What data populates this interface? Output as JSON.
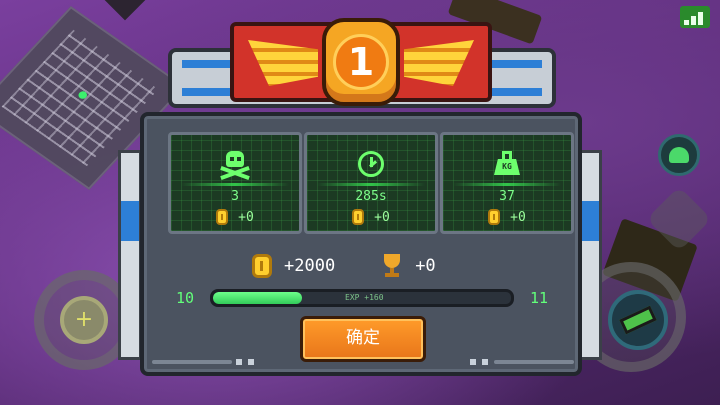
{
  "rank": {
    "number": "1"
  },
  "stats": [
    {
      "icon": "skull-crossbones-icon",
      "value": "3",
      "reward": "+0"
    },
    {
      "icon": "clock-icon",
      "value": "285s",
      "reward": "+0"
    },
    {
      "icon": "weight-icon",
      "icon_text": "KG",
      "value": "37",
      "reward": "+0"
    }
  ],
  "totals": {
    "coins": "+2000",
    "trophies": "+0"
  },
  "level": {
    "current": "10",
    "next": "11",
    "exp_label": "EXP +160",
    "progress": 0.3
  },
  "confirm_button": {
    "label": "确定"
  },
  "colors": {
    "accent_green": "#62ff7a",
    "button_orange": "#ff9b2a",
    "banner_red": "#d2332a",
    "medal_orange": "#f5a623"
  }
}
